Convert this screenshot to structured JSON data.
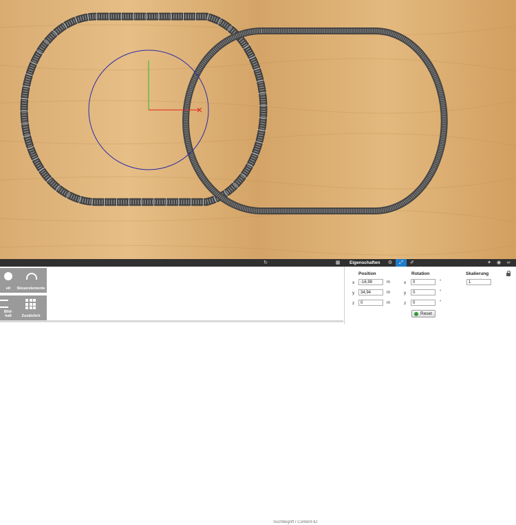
{
  "toolbar": {
    "search_placeholder": "Suchbegriff / Content-ID",
    "properties_title": "Eigenschaften"
  },
  "catalog": {
    "tiles": [
      {
        "label": "eit",
        "icon": "half-circle-icon"
      },
      {
        "label": "Steuerelemente",
        "icon": "speedometer-icon"
      },
      {
        "label": "Bild-\nhalt",
        "icon": "list-icon"
      },
      {
        "label": "Zusätzlich",
        "icon": "grid-icon"
      }
    ]
  },
  "properties": {
    "position": {
      "header": "Position",
      "x": {
        "axis": "x",
        "value": "-16,99",
        "unit": "m"
      },
      "y": {
        "axis": "y",
        "value": "34,94",
        "unit": "m"
      },
      "z": {
        "axis": "z",
        "value": "0",
        "unit": "m"
      }
    },
    "rotation": {
      "header": "Rotation",
      "x": {
        "axis": "x",
        "value": "0",
        "unit": "°"
      },
      "y": {
        "axis": "y",
        "value": "0",
        "unit": "°"
      },
      "z": {
        "axis": "z",
        "value": "0",
        "unit": "°"
      }
    },
    "scale": {
      "header": "Skalierung",
      "value": "1"
    },
    "reset_label": "Reset"
  },
  "colors": {
    "wood_light": "#e0b883",
    "wood_dark": "#c99456",
    "track_rail": "#5a5a5a",
    "selection_circle": "#2a2aa8",
    "gizmo_x": "#e02020",
    "gizmo_y": "#22c022",
    "bar": "#303030",
    "accent": "#1e7bc8"
  }
}
